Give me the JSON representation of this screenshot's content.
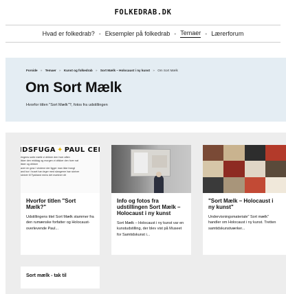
{
  "site": {
    "title": "FOLKEDRAB.DK"
  },
  "nav": {
    "items": [
      {
        "label": "Hvad er folkedrab?"
      },
      {
        "label": "Eksempler på folkedrab"
      },
      {
        "label": "Temaer"
      },
      {
        "label": "Lærerforum"
      }
    ],
    "separator": "-",
    "active": "Temaer"
  },
  "breadcrumb": {
    "items": [
      "Forside",
      "Temaer",
      "Kunst og folkedrab",
      "Sort Mælk – Holocaust i ny kunst"
    ],
    "current": "Om Sort Mælk",
    "separator": "»"
  },
  "hero": {
    "title": "Om Sort Mælk",
    "subtitle": "Hvorfor titlen \"Sort Mælk\"?, fotos fra udstillingen"
  },
  "cards": [
    {
      "title": "Hvorfor titlen \"Sort Mælk?\"",
      "text": "Udstillingens titel Sort Mælk stammer fra den rumænske forfatter og Holocaust-overlevende Paul...",
      "image": {
        "headline_left": "IDSFUGA",
        "headline_right": "PAUL CELAN",
        "lines": [
          "ringens sorte mælk vi drikker den hver aften",
          "ikker den middag og morgen vi drikker den hver nat",
          "ikker og drikker",
          "aver en grav i vindene der ligger man ikke trangt",
          "and bor i huset han leger med slangerne han skriver",
          "skriver til Tyskland mens det mørkner dit"
        ]
      }
    },
    {
      "title": "Info og fotos fra udstillingen Sort Mælk – Holocaust i ny kunst",
      "text": "Sort Mælk – Holocaust i ny kunst var en kunstudstilling, der blev vist på Museet for Samtidskunst i..."
    },
    {
      "title": "\"Sort Mælk – Holocaust i ny kunst\"",
      "text": "Undervisningsmateriale\" Sort mælk\" handler om Holocaust i ny kunst. Tretten samtidskunstværker..."
    },
    {
      "title": "Sort mælk - tak til",
      "text": ""
    }
  ],
  "colors": {
    "hero_bg": "#e4edf3",
    "section_bg": "#ededed",
    "star": "#e2b20a"
  }
}
